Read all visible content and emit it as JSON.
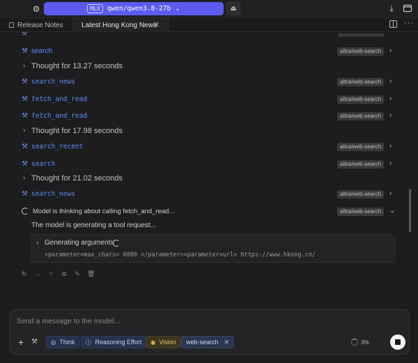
{
  "header": {
    "model_badge": "MLX",
    "model_name": "qwen/qwen3.8-27b"
  },
  "tabs": [
    {
      "label": "Release Notes"
    },
    {
      "label": "Latest Hong Kong News"
    }
  ],
  "timeline": [
    {
      "type": "tool",
      "name": "search",
      "badge": "altra/web-search"
    },
    {
      "type": "thought",
      "text": "Thought for 13.27 seconds"
    },
    {
      "type": "tool",
      "name": "search_news",
      "badge": "altra/web-search"
    },
    {
      "type": "tool",
      "name": "fetch_and_read",
      "badge": "altra/web-search"
    },
    {
      "type": "tool",
      "name": "fetch_and_read",
      "badge": "altra/web-search"
    },
    {
      "type": "thought",
      "text": "Thought for 17.98 seconds"
    },
    {
      "type": "tool",
      "name": "search_recent",
      "badge": "altra/web-search"
    },
    {
      "type": "tool",
      "name": "search",
      "badge": "altra/web-search"
    },
    {
      "type": "thought",
      "text": "Thought for 21.02 seconds"
    },
    {
      "type": "tool",
      "name": "search_news",
      "badge": "altra/web-search"
    },
    {
      "type": "thinking",
      "text": "Model is thinking about calling fetch_and_read...",
      "badge": "altra/web-search"
    }
  ],
  "generating": {
    "status": "The model is generating a tool request...",
    "label": "Generating arguments",
    "code": "<parameter=max_chars> 6000 </parameter><parameter=url> https://www.hkong.cn/"
  },
  "composer": {
    "placeholder": "Send a message to the model...",
    "chips": {
      "think": "Think",
      "effort": "Reasoning Effort",
      "vision": "Vision",
      "web": "web-search"
    },
    "context_pct": "3%"
  },
  "icons": {
    "settings": "gear-icon",
    "download": "download-icon",
    "eject": "eject-icon",
    "tool": "wrench-icon",
    "stop": "stop-icon"
  },
  "colors": {
    "accent": "#5b5bf0",
    "tool_name": "#5d8cf5",
    "background": "#1d1d1f"
  }
}
